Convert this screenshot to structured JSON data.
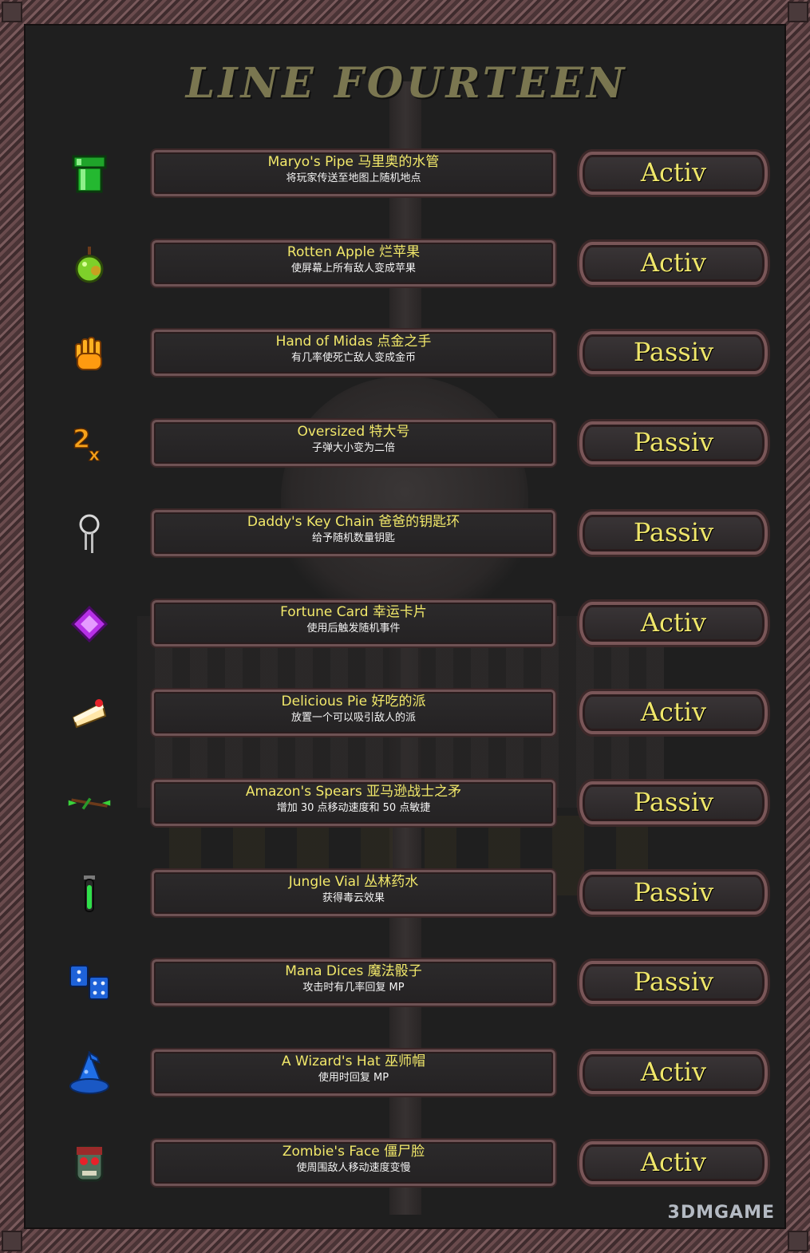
{
  "title": "LINE FOURTEEN",
  "items": [
    {
      "icon": "green-pipe-icon",
      "name": "Maryo's Pipe 马里奥的水管",
      "desc": "将玩家传送至地图上随机地点",
      "type": "Activ"
    },
    {
      "icon": "rotten-apple-icon",
      "name": "Rotten Apple 烂苹果",
      "desc": "使屏幕上所有敌人变成苹果",
      "type": "Activ"
    },
    {
      "icon": "golden-hand-icon",
      "name": "Hand of Midas 点金之手",
      "desc": "有几率使死亡敌人变成金币",
      "type": "Passiv"
    },
    {
      "icon": "double-size-icon",
      "name": "Oversized 特大号",
      "desc": "子弹大小变为二倍",
      "type": "Passiv"
    },
    {
      "icon": "key-chain-icon",
      "name": "Daddy's Key Chain 爸爸的钥匙环",
      "desc": "给予随机数量钥匙",
      "type": "Passiv"
    },
    {
      "icon": "fortune-card-icon",
      "name": "Fortune Card 幸运卡片",
      "desc": "使用后触发随机事件",
      "type": "Activ"
    },
    {
      "icon": "cake-slice-icon",
      "name": "Delicious Pie 好吃的派",
      "desc": "放置一个可以吸引敌人的派",
      "type": "Activ"
    },
    {
      "icon": "spears-icon",
      "name": "Amazon's Spears 亚马逊战士之矛",
      "desc": "增加 30 点移动速度和 50 点敏捷",
      "type": "Passiv"
    },
    {
      "icon": "vial-icon",
      "name": "Jungle Vial 丛林药水",
      "desc": "获得毒云效果",
      "type": "Passiv"
    },
    {
      "icon": "dice-icon",
      "name": "Mana Dices 魔法骰子",
      "desc": "攻击时有几率回复 MP",
      "type": "Passiv"
    },
    {
      "icon": "wizard-hat-icon",
      "name": "A Wizard's Hat 巫师帽",
      "desc": "使用时回复 MP",
      "type": "Activ"
    },
    {
      "icon": "zombie-face-icon",
      "name": "Zombie's Face 僵尸脸",
      "desc": "使周围敌人移动速度变慢",
      "type": "Activ"
    }
  ],
  "watermark": "3DMGAME",
  "colors": {
    "name_text": "#f2e86a",
    "desc_text": "#f4f4f4",
    "type_text": "#efe66a",
    "title_text": "#7a7650",
    "frame": "#6a4b4d"
  }
}
